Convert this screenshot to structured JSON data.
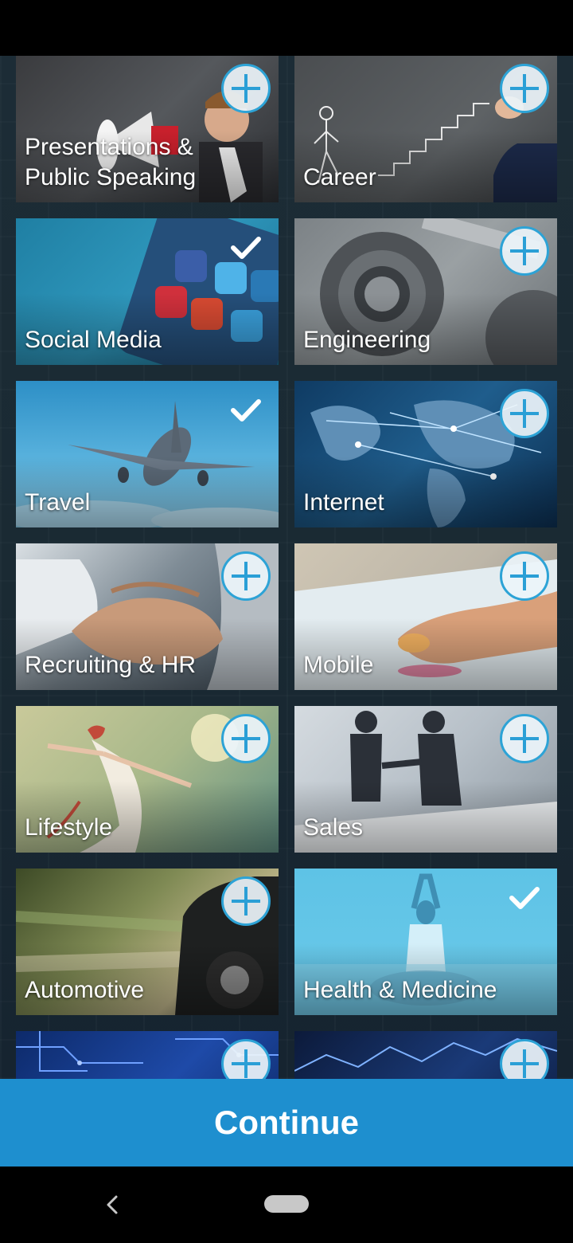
{
  "colors": {
    "accent": "#1e8fcf",
    "plus_ring": "#2da3d6"
  },
  "categories": [
    {
      "label": "Presentations &\nPublic Speaking",
      "state": "add",
      "icon": "plus-icon"
    },
    {
      "label": "Career",
      "state": "add",
      "icon": "plus-icon"
    },
    {
      "label": "Social Media",
      "state": "selected",
      "icon": "check-icon"
    },
    {
      "label": "Engineering",
      "state": "add",
      "icon": "plus-icon"
    },
    {
      "label": "Travel",
      "state": "selected",
      "icon": "check-icon"
    },
    {
      "label": "Internet",
      "state": "add",
      "icon": "plus-icon"
    },
    {
      "label": "Recruiting & HR",
      "state": "add",
      "icon": "plus-icon"
    },
    {
      "label": "Mobile",
      "state": "add",
      "icon": "plus-icon"
    },
    {
      "label": "Lifestyle",
      "state": "add",
      "icon": "plus-icon"
    },
    {
      "label": "Sales",
      "state": "add",
      "icon": "plus-icon"
    },
    {
      "label": "Automotive",
      "state": "add",
      "icon": "plus-icon"
    },
    {
      "label": "Health & Medicine",
      "state": "selected",
      "icon": "check-icon"
    },
    {
      "label": "",
      "state": "add",
      "icon": "plus-icon"
    },
    {
      "label": "",
      "state": "add",
      "icon": "plus-icon"
    }
  ],
  "continue_label": "Continue",
  "nav": {
    "back_icon": "back-icon",
    "home_icon": "home-pill-icon"
  }
}
